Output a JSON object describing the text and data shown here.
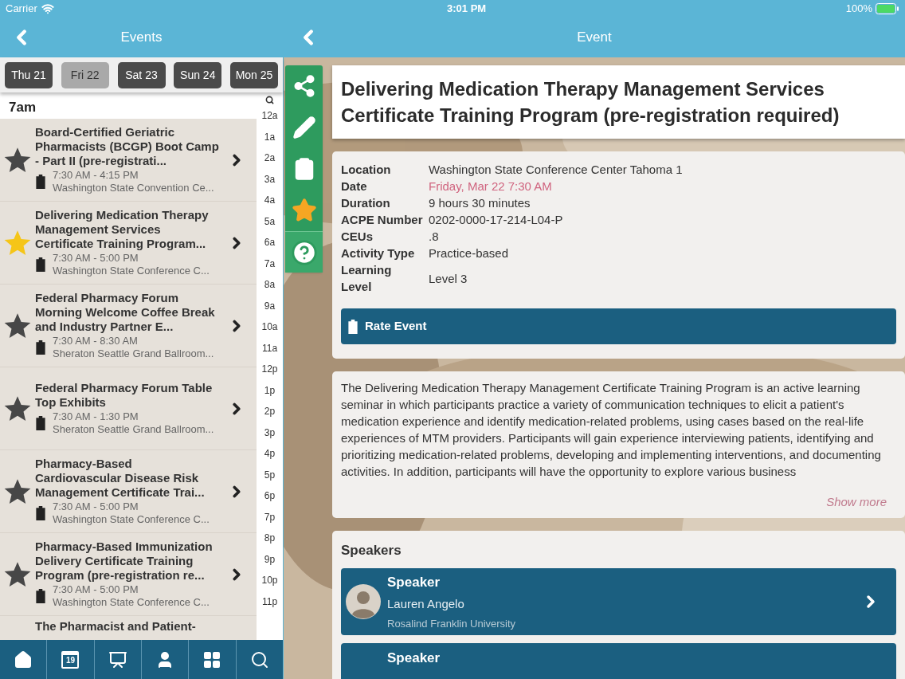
{
  "status_bar": {
    "carrier": "Carrier",
    "time": "3:01 PM",
    "battery": "100%"
  },
  "events_panel": {
    "title": "Events",
    "days": [
      {
        "label": "Thu 21",
        "selected": false
      },
      {
        "label": "Fri 22",
        "selected": true
      },
      {
        "label": "Sat 23",
        "selected": false
      },
      {
        "label": "Sun 24",
        "selected": false
      },
      {
        "label": "Mon 25",
        "selected": false
      }
    ],
    "current_hour": "7am",
    "events": [
      {
        "title": "Board-Certified Geriatric Pharmacists (BCGP) Boot Camp - Part II (pre-registrati...",
        "time": "7:30 AM - 4:15 PM",
        "location": "Washington State Convention Ce...",
        "favorite": false
      },
      {
        "title": "Delivering Medication Therapy Management Services Certificate Training Program...",
        "time": "7:30 AM - 5:00 PM",
        "location": "Washington State Conference C...",
        "favorite": true
      },
      {
        "title": "Federal Pharmacy Forum Morning Welcome Coffee Break and Industry Partner E...",
        "time": "7:30 AM - 8:30 AM",
        "location": "Sheraton Seattle Grand Ballroom...",
        "favorite": false
      },
      {
        "title": "Federal Pharmacy Forum Table Top Exhibits",
        "time": "7:30 AM - 1:30 PM",
        "location": "Sheraton Seattle Grand Ballroom...",
        "favorite": false
      },
      {
        "title": "Pharmacy-Based Cardiovascular Disease Risk Management Certificate Trai...",
        "time": "7:30 AM - 5:00 PM",
        "location": "Washington State Conference C...",
        "favorite": false
      },
      {
        "title": "Pharmacy-Based Immunization Delivery Certificate Training Program (pre-registration re...",
        "time": "7:30 AM - 5:00 PM",
        "location": "Washington State Conference C...",
        "favorite": false
      },
      {
        "title": "The Pharmacist and Patient-"
      }
    ],
    "hours": [
      "12a",
      "1a",
      "2a",
      "3a",
      "4a",
      "5a",
      "6a",
      "7a",
      "8a",
      "9a",
      "10a",
      "11a",
      "12p",
      "1p",
      "2p",
      "3p",
      "4p",
      "5p",
      "6p",
      "7p",
      "8p",
      "9p",
      "10p",
      "11p"
    ],
    "tab_bar": [
      {
        "kind": "home"
      },
      {
        "kind": "calendar",
        "label": "19"
      },
      {
        "kind": "presenter"
      },
      {
        "kind": "person"
      },
      {
        "kind": "grid"
      },
      {
        "kind": "search"
      }
    ]
  },
  "event_panel": {
    "title": "Event",
    "actions": [
      {
        "kind": "share"
      },
      {
        "kind": "edit"
      },
      {
        "kind": "clipboard"
      },
      {
        "kind": "star"
      },
      {
        "kind": "help"
      }
    ],
    "event_title": "Delivering Medication Therapy Management Services Certificate Training Program (pre-registration required)",
    "details": [
      {
        "label": "Location",
        "value": "Washington State Conference Center Tahoma 1",
        "kind": "plain"
      },
      {
        "label": "Date",
        "value": "Friday, Mar 22 7:30 AM",
        "kind": "date"
      },
      {
        "label": "Duration",
        "value": "9 hours 30 minutes",
        "kind": "plain"
      },
      {
        "label": "ACPE Number",
        "value": "0202-0000-17-214-L04-P",
        "kind": "plain"
      },
      {
        "label": "CEUs",
        "value": ".8",
        "kind": "plain"
      },
      {
        "label": "Activity Type",
        "value": "Practice-based",
        "kind": "plain"
      },
      {
        "label": "Learning Level",
        "value": "Level 3",
        "kind": "plain"
      }
    ],
    "rate_button": "Rate Event",
    "description": "The Delivering Medication Therapy Management Certificate Training Program is an active learning seminar in which participants practice a variety of communication techniques to elicit a patient's medication experience and identify medication-related problems, using cases based on the real-life experiences of MTM providers. Participants will gain experience interviewing patients, identifying and prioritizing medication-related problems, developing and implementing interventions, and documenting activities. In addition, participants will have the opportunity to explore various business",
    "show_more": "Show more",
    "speakers_heading": "Speakers",
    "speakers": [
      {
        "role": "Speaker",
        "name": "Lauren Angelo",
        "affiliation": "Rosalind Franklin University"
      },
      {
        "role": "Speaker"
      }
    ]
  }
}
